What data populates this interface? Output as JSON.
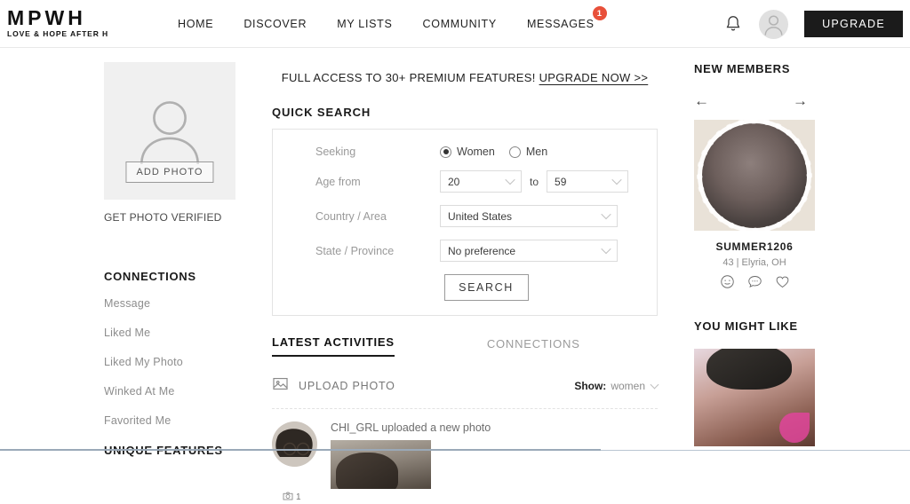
{
  "header": {
    "logo": "MPWH",
    "logo_tagline": "LOVE & HOPE AFTER H",
    "nav": [
      {
        "label": "HOME",
        "badge": ""
      },
      {
        "label": "DISCOVER",
        "badge": ""
      },
      {
        "label": "MY LISTS",
        "badge": ""
      },
      {
        "label": "COMMUNITY",
        "badge": ""
      },
      {
        "label": "MESSAGES",
        "badge": "1"
      }
    ],
    "notification_icon": "bell-icon",
    "avatar_icon": "user-avatar-icon",
    "upgrade_label": "UPGRADE",
    "badge_color": "#e8503a",
    "upgrade_bg": "#1b1b1b"
  },
  "left_sidebar": {
    "photo_placeholder_icon": "user-silhouette-icon",
    "add_photo_label": "ADD PHOTO",
    "verify_label": "GET PHOTO VERIFIED",
    "connections_heading": "CONNECTIONS",
    "connections_items": [
      {
        "label": "Message"
      },
      {
        "label": "Liked Me"
      },
      {
        "label": "Liked My Photo"
      },
      {
        "label": "Winked At Me"
      },
      {
        "label": "Favorited Me"
      }
    ],
    "unique_features_heading": "UNIQUE FEATURES"
  },
  "promo": {
    "text": "FULL ACCESS TO 30+ PREMIUM FEATURES!",
    "link": "UPGRADE NOW >>"
  },
  "quick_search": {
    "title": "QUICK SEARCH",
    "seeking_label": "Seeking",
    "seeking_options": [
      {
        "label": "Women",
        "selected": true
      },
      {
        "label": "Men",
        "selected": false
      }
    ],
    "age_label": "Age from",
    "age_from": "20",
    "age_to_label": "to",
    "age_to": "59",
    "country_label": "Country / Area",
    "country_value": "United States",
    "state_label": "State / Province",
    "state_value": "No preference",
    "search_button": "SEARCH"
  },
  "tabs": [
    {
      "label": "LATEST ACTIVITIES",
      "active": true
    },
    {
      "label": "CONNECTIONS",
      "active": false
    }
  ],
  "feed": {
    "upload_icon": "image-upload-icon",
    "upload_label": "UPLOAD PHOTO",
    "show_label": "Show:",
    "show_value": "women",
    "activities": [
      {
        "user": "CHI_GRL",
        "text": "CHI_GRL uploaded a new photo",
        "photo_count": "1",
        "photo_count_icon": "camera-icon"
      }
    ]
  },
  "right_sidebar": {
    "new_members_heading": "NEW MEMBERS",
    "prev_arrow": "←",
    "next_arrow": "→",
    "member": {
      "name": "SUMMER1206",
      "meta": "43 | Elyria, OH",
      "actions": [
        {
          "icon": "wink-smiley-icon"
        },
        {
          "icon": "message-bubble-icon"
        },
        {
          "icon": "heart-icon"
        }
      ]
    },
    "you_might_like_heading": "YOU MIGHT LIKE"
  }
}
